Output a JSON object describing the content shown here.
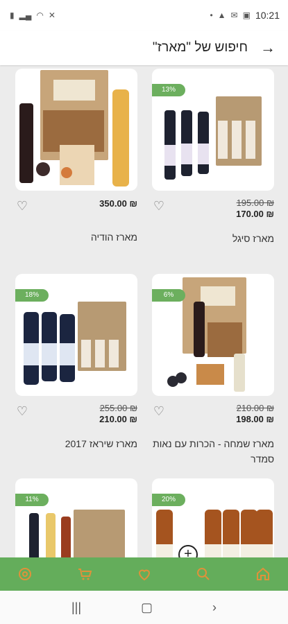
{
  "status_bar": {
    "time": "10:21"
  },
  "header": {
    "title": "חיפוש של \"מארז\"",
    "back_icon": "arrow-right-icon"
  },
  "products": [
    {
      "name": "מארז סיגל",
      "badge": "13%",
      "old_price": "195.00 ₪",
      "new_price": "170.00 ₪"
    },
    {
      "name": "מארז הודיה",
      "badge": "",
      "old_price": "",
      "new_price": "350.00 ₪"
    },
    {
      "name": "מארז שמחה - הכרות עם נאות סמדר",
      "badge": "6%",
      "old_price": "210.00 ₪",
      "new_price": "198.00 ₪"
    },
    {
      "name": "מארז שיראז 2017",
      "badge": "18%",
      "old_price": "255.00 ₪",
      "new_price": "210.00 ₪"
    },
    {
      "name": "",
      "badge": "20%",
      "old_price": "",
      "new_price": ""
    },
    {
      "name": "",
      "badge": "11%",
      "old_price": "",
      "new_price": ""
    }
  ],
  "bottom_nav": {
    "items": [
      "settings-icon",
      "cart-icon",
      "heart-icon",
      "search-icon",
      "home-icon"
    ],
    "icon_color": "#e0913a",
    "bar_color": "#64ad5b"
  }
}
